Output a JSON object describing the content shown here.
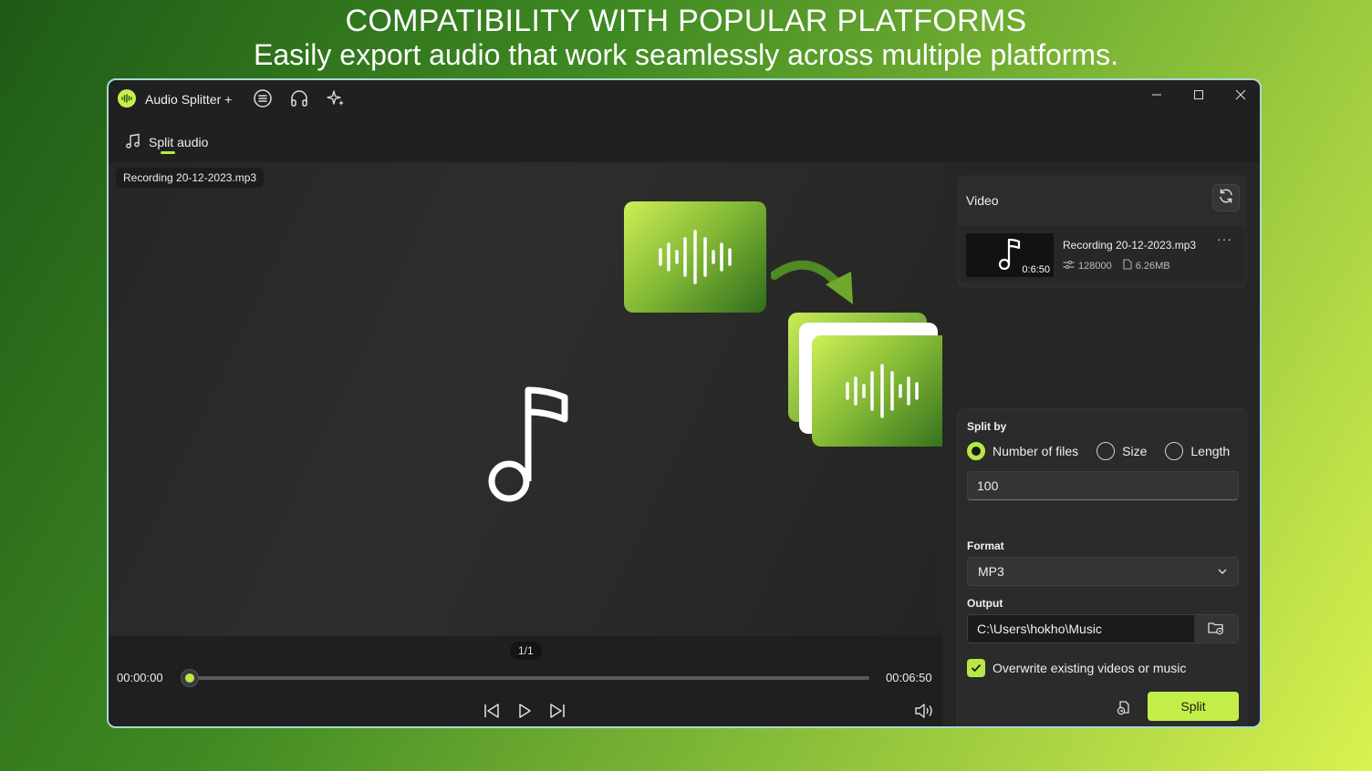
{
  "promo": {
    "title": "COMPATIBILITY WITH POPULAR PLATFORMS",
    "subtitle": "Easily export audio that work seamlessly across multiple platforms."
  },
  "titlebar": {
    "app_name": "Audio Splitter +",
    "icons": [
      "list-icon",
      "headphones-icon",
      "sparkle-icon"
    ],
    "window_controls": [
      "minimize",
      "maximize",
      "close"
    ]
  },
  "nav": {
    "tab_label": "Split audio"
  },
  "preview": {
    "file_name": "Recording 20-12-2023.mp3",
    "page_indicator": "1/1",
    "time_start": "00:00:00",
    "time_end": "00:06:50",
    "progress": 0
  },
  "video_panel": {
    "title": "Video",
    "file": {
      "name": "Recording 20-12-2023.mp3",
      "duration": "0:6:50",
      "bitrate": "128000",
      "size": "6.26MB"
    }
  },
  "settings": {
    "split_by_label": "Split by",
    "options": [
      "Number of files",
      "Size",
      "Length"
    ],
    "selected_option": "Number of files",
    "count_value": "100",
    "format_label": "Format",
    "format_value": "MP3",
    "output_label": "Output",
    "output_path": "C:\\Users\\hokho\\Music",
    "overwrite_label": "Overwrite existing videos or music",
    "overwrite_checked": true,
    "split_button": "Split"
  },
  "colors": {
    "accent": "#C4EE4A",
    "window_bg": "#202020",
    "panel_bg": "#2B2B2B"
  }
}
